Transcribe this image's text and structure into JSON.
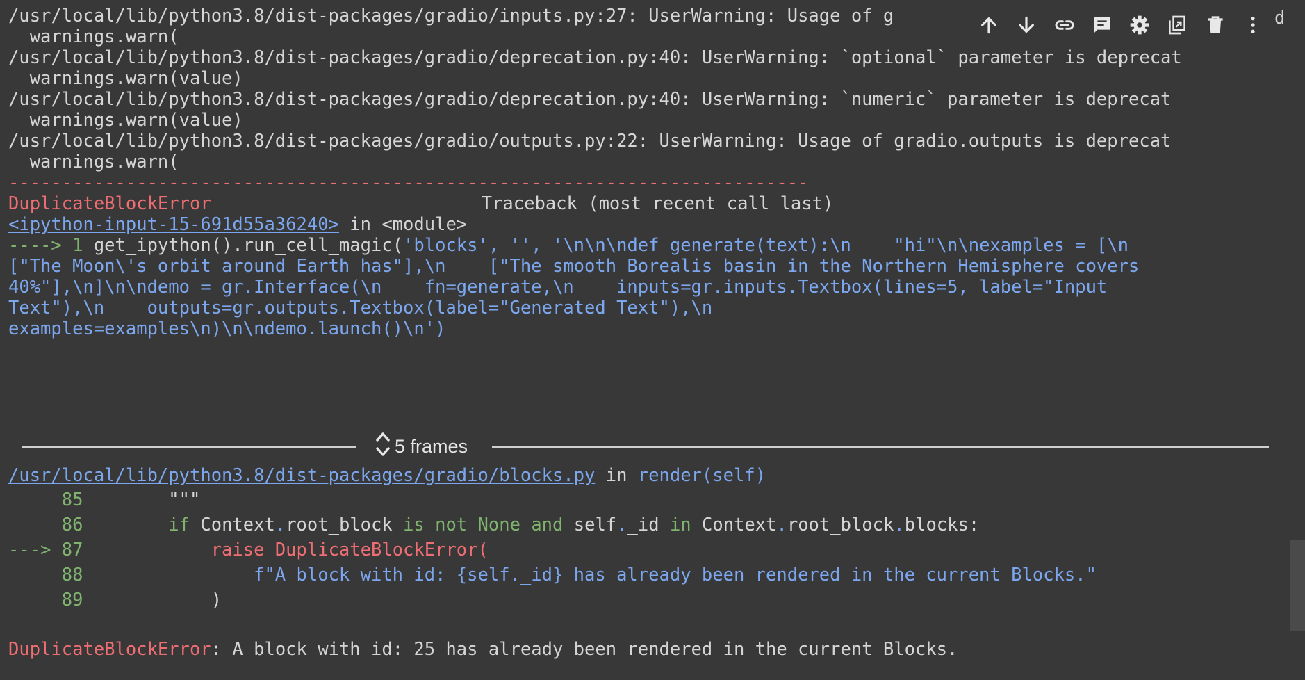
{
  "toolbar": {
    "buttons": [
      {
        "name": "move-up",
        "icon": "arrow-up-icon"
      },
      {
        "name": "move-down",
        "icon": "arrow-down-icon"
      },
      {
        "name": "link",
        "icon": "link-icon"
      },
      {
        "name": "comment",
        "icon": "comment-icon"
      },
      {
        "name": "settings",
        "icon": "gear-icon"
      },
      {
        "name": "mirror-cell",
        "icon": "mirror-icon"
      },
      {
        "name": "delete",
        "icon": "trash-icon"
      },
      {
        "name": "more",
        "icon": "more-vert-icon"
      }
    ]
  },
  "warnings": [
    "/usr/local/lib/python3.8/dist-packages/gradio/inputs.py:27: UserWarning: Usage of g",
    "  warnings.warn(",
    "/usr/local/lib/python3.8/dist-packages/gradio/deprecation.py:40: UserWarning: `optional` parameter is deprecat",
    "  warnings.warn(value)",
    "/usr/local/lib/python3.8/dist-packages/gradio/deprecation.py:40: UserWarning: `numeric` parameter is deprecat",
    "  warnings.warn(value)",
    "/usr/local/lib/python3.8/dist-packages/gradio/outputs.py:22: UserWarning: Usage of gradio.outputs is deprecat",
    "  warnings.warn("
  ],
  "warning_tail_char": "d",
  "traceback": {
    "separator": "---------------------------------------------------------------------------",
    "error_name": "DuplicateBlockError",
    "header_right": "Traceback (most recent call last)",
    "input_link": "<ipython-input-15-691d55a36240>",
    "in_module": " in <module>",
    "arrow1": "----> 1 ",
    "call_fn": "get_ipython().run_cell_magic(",
    "call_lines": [
      "'blocks', '', '\\n\\n\\ndef generate(text):\\n    \"hi\"\\n\\nexamples = [\\n",
      "[\"The Moon\\'s orbit around Earth has\"],\\n    [\"The smooth Borealis basin in the Northern Hemisphere covers",
      "40%\"],\\n]\\n\\ndemo = gr.Interface(\\n    fn=generate,\\n    inputs=gr.inputs.Textbox(lines=5, label=\"Input",
      "Text\"),\\n    outputs=gr.outputs.Textbox(label=\"Generated Text\"),\\n",
      "examples=examples\\n)\\n\\ndemo.launch()\\n')"
    ],
    "frames_label": "5 frames",
    "blocks_link": "/usr/local/lib/python3.8/dist-packages/gradio/blocks.py",
    "blocks_in": " in ",
    "blocks_fn": "render(self)",
    "code": {
      "l85_num": "     85",
      "l85_text": "        \"\"\"",
      "l86_num": "     86",
      "l86_if": "        if ",
      "l86_ctx": "Context",
      "l86_dot1": ".",
      "l86_rootblock": "root_block ",
      "l86_isnot": "is not",
      "l86_none": " None ",
      "l86_and": "and",
      "l86_self": " self",
      "l86_dot2": ".",
      "l86_id": "_id ",
      "l86_in": "in",
      "l86_ctx2": " Context",
      "l86_dot3": ".",
      "l86_rb2": "root_block",
      "l86_dot4": ".",
      "l86_blocks": "blocks:",
      "l87_arrow": "---> 87",
      "l87_raise": "            raise ",
      "l87_err": "DuplicateBlockError(",
      "l88_num": "     88",
      "l88_text": "                f\"A block with id: {self._id} has already been rendered in the current Blocks.\"",
      "l89_num": "     89",
      "l89_text": "            )"
    },
    "final_error_name": "DuplicateBlockError",
    "final_message": ": A block with id: 25 has already been rendered in the current Blocks."
  }
}
